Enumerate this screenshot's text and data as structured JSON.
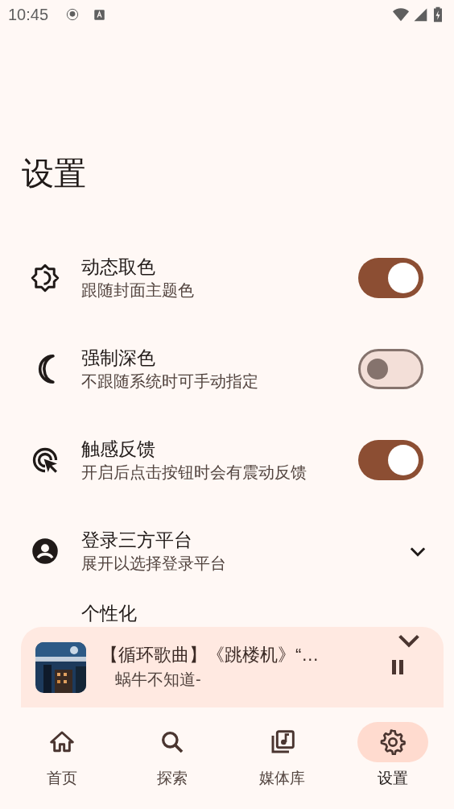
{
  "status_bar": {
    "time": "10:45"
  },
  "title": "设置",
  "settings": [
    {
      "kind": "toggle",
      "title": "动态取色",
      "subtitle": "跟随封面主题色",
      "on": true
    },
    {
      "kind": "toggle",
      "title": "强制深色",
      "subtitle": "不跟随系统时可手动指定",
      "on": false
    },
    {
      "kind": "toggle",
      "title": "触感反馈",
      "subtitle": "开启后点击按钮时会有震动反馈",
      "on": true
    },
    {
      "kind": "expand",
      "title": "登录三方平台",
      "subtitle": "展开以选择登录平台",
      "expanded": false
    }
  ],
  "partial_setting": {
    "title": "个性化"
  },
  "player": {
    "title": "【循环歌曲】《跳楼机》“…",
    "artist": "蜗牛不知道-",
    "playing": true
  },
  "nav": [
    {
      "label": "首页",
      "selected": false
    },
    {
      "label": "探索",
      "selected": false
    },
    {
      "label": "媒体库",
      "selected": false
    },
    {
      "label": "设置",
      "selected": true
    }
  ]
}
